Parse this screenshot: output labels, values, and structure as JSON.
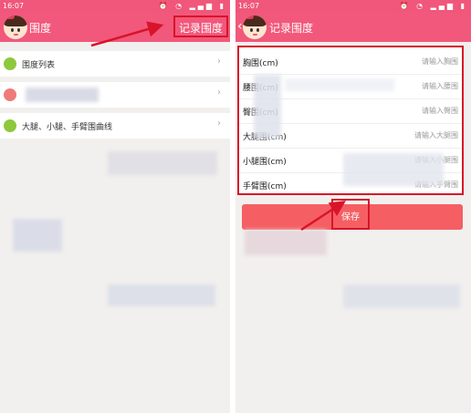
{
  "left": {
    "status": {
      "time": "16:07"
    },
    "title": "围度",
    "record_button": "记录围度",
    "items": [
      {
        "label": "围度列表",
        "icon": "list-icon",
        "color": "#8dc83d"
      },
      {
        "label": "",
        "icon": "circle-icon",
        "color": "#f07a7a"
      },
      {
        "label": "大腿、小腿、手臂围曲线",
        "icon": "chart-icon",
        "color": "#8dc83d"
      }
    ]
  },
  "right": {
    "status": {
      "time": "16:07"
    },
    "title": "记录围度",
    "fields": [
      {
        "label": "胸围(cm)",
        "placeholder": "请输入胸围"
      },
      {
        "label": "腰围(cm)",
        "placeholder": "请输入腰围"
      },
      {
        "label": "臀围(cm)",
        "placeholder": "请输入臀围"
      },
      {
        "label": "大腿围(cm)",
        "placeholder": "请输入大腿围"
      },
      {
        "label": "小腿围(cm)",
        "placeholder": "请输入小腿围"
      },
      {
        "label": "手臂围(cm)",
        "placeholder": "请输入手臂围"
      }
    ],
    "save_button": "保存"
  },
  "colors": {
    "accent": "#f2587b",
    "highlight": "#d8142a",
    "save": "#f55f63"
  }
}
